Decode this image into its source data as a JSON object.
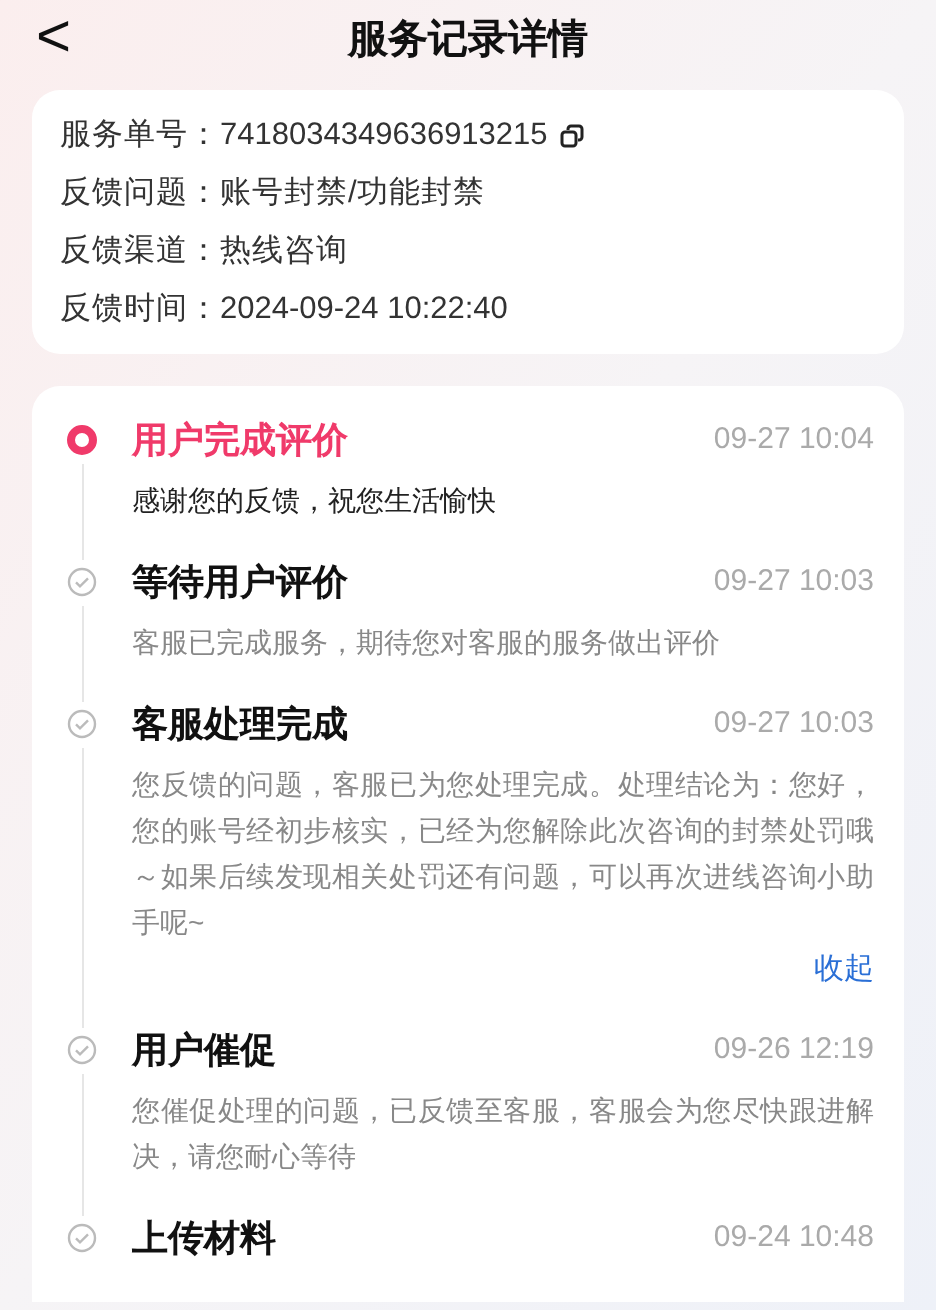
{
  "header": {
    "back": "<",
    "title": "服务记录详情"
  },
  "info": [
    {
      "label": "服务单号：",
      "value": "7418034349636913215",
      "copyable": true
    },
    {
      "label": "反馈问题：",
      "value": "账号封禁/功能封禁",
      "copyable": false
    },
    {
      "label": "反馈渠道：",
      "value": "热线咨询",
      "copyable": false
    },
    {
      "label": "反馈时间：",
      "value": "2024-09-24 10:22:40",
      "copyable": false
    }
  ],
  "timeline": [
    {
      "title": "用户完成评价",
      "time": "09-27 10:04",
      "body": "感谢您的反馈，祝您生活愉快",
      "selected": true
    },
    {
      "title": "等待用户评价",
      "time": "09-27 10:03",
      "body": "客服已完成服务，期待您对客服的服务做出评价",
      "selected": false
    },
    {
      "title": "客服处理完成",
      "time": "09-27 10:03",
      "body": "您反馈的问题，客服已为您处理完成。处理结论为：您好，您的账号经初步核实，已经为您解除此次咨询的封禁处罚哦～如果后续发现相关处罚还有问题，可以再次进线咨询小助手呢~",
      "link": "收起",
      "selected": false
    },
    {
      "title": "用户催促",
      "time": "09-26 12:19",
      "body": "您催促处理的问题，已反馈至客服，客服会为您尽快跟进解决，请您耐心等待",
      "selected": false
    },
    {
      "title": "上传材料",
      "time": "09-24 10:48",
      "selected": false
    }
  ]
}
